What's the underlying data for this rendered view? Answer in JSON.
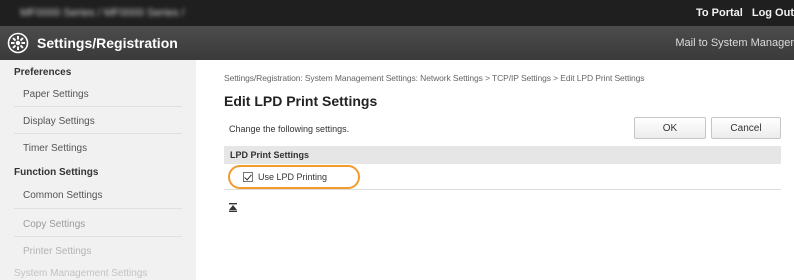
{
  "header": {
    "product_name": "MF0000 Series / MF0000 Series /",
    "links": [
      "To Portal",
      "Log Out"
    ]
  },
  "titlebar": {
    "title": "Settings/Registration",
    "mail_admin": "Mail to System Manager"
  },
  "sidebar": {
    "preferences_label": "Preferences",
    "preferences_items": [
      "Paper Settings",
      "Display Settings",
      "Timer Settings"
    ],
    "function_label": "Function Settings",
    "function_items": [
      "Common Settings",
      "Copy Settings",
      "Printer Settings"
    ],
    "system_label": "System Management Settings"
  },
  "main": {
    "breadcrumb": "Settings/Registration: System Management Settings: Network Settings > TCP/IP Settings > Edit LPD Print Settings",
    "page_title": "Edit LPD Print Settings",
    "instruction": "Change the following settings.",
    "ok_label": "OK",
    "cancel_label": "Cancel",
    "section_title": "LPD Print Settings",
    "checkbox_label": "Use LPD Printing",
    "checkbox_checked": true
  },
  "colors": {
    "top_bar": "#1f1f1f",
    "title_bar": "#444444",
    "sidebar_bg": "#f1f1f1",
    "highlight": "#f39a2d"
  }
}
